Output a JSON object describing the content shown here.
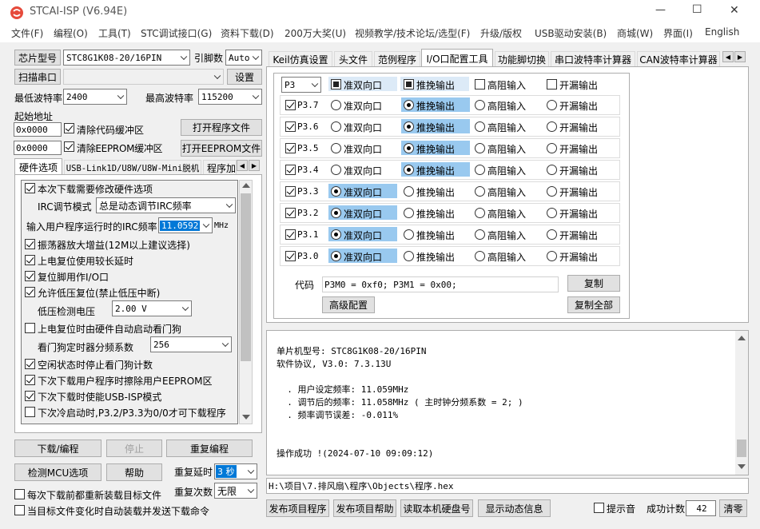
{
  "window": {
    "title": "STCAI-ISP (V6.94E)",
    "minimize": "—",
    "maximize": "☐",
    "close": "✕"
  },
  "menu": [
    "文件(F)",
    "编程(O)",
    "工具(T)",
    "STC调试接口(G)",
    "资料下载(D)",
    "200万大奖(U)",
    "视频教学/技术论坛/选型(F)",
    "升级/版权",
    "USB驱动安装(B)",
    "商城(W)",
    "界面(I)",
    "English"
  ],
  "left": {
    "chip_btn": "芯片型号",
    "chip_value": "STC8G1K08-20/16PIN",
    "pin_label": "引脚数",
    "pin_value": "Auto",
    "scan_btn": "扫描串口",
    "port_value": "",
    "settings_btn": "设置",
    "min_baud_label": "最低波特率",
    "min_baud": "2400",
    "max_baud_label": "最高波特率",
    "max_baud": "115200",
    "start_addr_label": "起始地址",
    "addr1": "0x0000",
    "clear_code": "清除代码缓冲区",
    "open_prog": "打开程序文件",
    "addr2": "0x0000",
    "clear_eeprom": "清除EEPROM缓冲区",
    "open_eeprom": "打开EEPROM文件",
    "tabs": [
      "硬件选项",
      "USB-Link1D/U8W/U8W-Mini脱机",
      "程序加"
    ],
    "hw": {
      "opt1": "本次下载需要修改硬件选项",
      "irc_mode_label": "IRC调节模式",
      "irc_mode": "总是动态调节IRC频率",
      "irc_freq_label": "输入用户程序运行时的IRC频率",
      "irc_freq": "11.0592",
      "mhz": "MHz",
      "opt2": "振荡器放大增益(12M以上建议选择)",
      "opt3": "上电复位使用较长延时",
      "opt4": "复位脚用作I/O口",
      "opt5": "允许低压复位(禁止低压中断)",
      "lvd_label": "低压检测电压",
      "lvd_value": "2.00 V",
      "opt6": "上电复位时由硬件自动启动看门狗",
      "wdt_label": "看门狗定时器分频系数",
      "wdt_value": "256",
      "opt7": "空闲状态时停止看门狗计数",
      "opt8": "下次下载用户程序时擦除用户EEPROM区",
      "opt9": "下次下载时使能USB-ISP模式",
      "opt10": "下次冷启动时,P3.2/P3.3为0/0才可下载程序"
    },
    "download_btn": "下载/编程",
    "stop_btn": "停止",
    "repeat_prog_btn": "重复编程",
    "detect_btn": "检测MCU选项",
    "help_btn": "帮助",
    "repeat_delay_label": "重复延时",
    "repeat_delay": "3 秒",
    "repeat_count_label": "重复次数",
    "repeat_count": "无限",
    "reload_label": "每次下载前都重新装载目标文件",
    "auto_label": "当目标文件变化时自动装载并发送下载命令"
  },
  "right": {
    "tabs": [
      "Keil仿真设置",
      "头文件",
      "范例程序",
      "I/O口配置工具",
      "功能脚切换",
      "串口波特率计算器",
      "CAN波特率计算器"
    ],
    "port_select": "P3",
    "headers": [
      "准双向口",
      "推挽输出",
      "高阻输入",
      "开漏输出"
    ],
    "pins": [
      {
        "name": "P3.7",
        "mode": 1
      },
      {
        "name": "P3.6",
        "mode": 1
      },
      {
        "name": "P3.5",
        "mode": 1
      },
      {
        "name": "P3.4",
        "mode": 1
      },
      {
        "name": "P3.3",
        "mode": 0
      },
      {
        "name": "P3.2",
        "mode": 0
      },
      {
        "name": "P3.1",
        "mode": 0
      },
      {
        "name": "P3.0",
        "mode": 0
      }
    ],
    "code_label": "代码",
    "code_value": "P3M0 = 0xf0; P3M1 = 0x00;",
    "copy_btn": "复制",
    "advanced_btn": "高级配置",
    "copy_all_btn": "复制全部",
    "log": [
      "单片机型号: STC8G1K08-20/16PIN",
      "软件协议, V3.0: 7.3.13U",
      "",
      "  . 用户设定频率: 11.059MHz",
      "  . 调节后的频率: 11.058MHz ( 主时钟分频系数 = 2; )",
      "  . 频率调节误差: -0.011%",
      "",
      "",
      "操作成功 !(2024-07-10 09:09:12)"
    ],
    "path": "H:\\项目\\7.排风扇\\程序\\Objects\\程序.hex",
    "publish_prog": "发布项目程序",
    "publish_help": "发布项目帮助",
    "read_disk": "读取本机硬盘号",
    "show_dynamic": "显示动态信息",
    "sound_label": "提示音",
    "success_label": "成功计数",
    "success_count": "42",
    "clear_btn": "清零"
  }
}
